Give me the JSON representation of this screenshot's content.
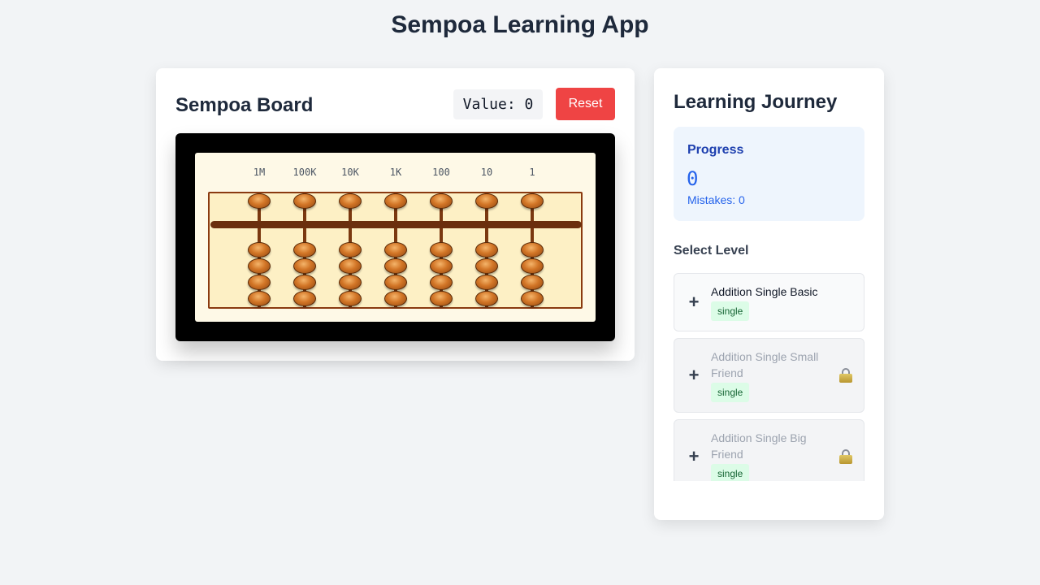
{
  "app": {
    "title": "Sempoa Learning App"
  },
  "board": {
    "title": "Sempoa Board",
    "value_text": "Value: 0",
    "reset_label": "Reset",
    "place_values": [
      "1M",
      "100K",
      "10K",
      "1K",
      "100",
      "10",
      "1"
    ],
    "upper_beads_per_rod": 1,
    "lower_beads_per_rod": 4,
    "current_value": 0
  },
  "journey": {
    "title": "Learning Journey",
    "progress": {
      "label": "Progress",
      "value": "0",
      "mistakes_text": "Mistakes: 0"
    },
    "select_level_label": "Select Level",
    "levels": [
      {
        "name": "Addition Single Basic",
        "tag": "single",
        "icon": "plus-icon",
        "locked": false
      },
      {
        "name": "Addition Single Small Friend",
        "tag": "single",
        "icon": "plus-icon",
        "locked": true
      },
      {
        "name": "Addition Single Big Friend",
        "tag": "single",
        "icon": "plus-icon",
        "locked": true
      }
    ]
  },
  "colors": {
    "reset": "#ef4444",
    "progress_bg": "#eef5fd",
    "progress_text": "#2563eb",
    "tag_bg": "#dcfce7",
    "tag_text": "#166534"
  }
}
